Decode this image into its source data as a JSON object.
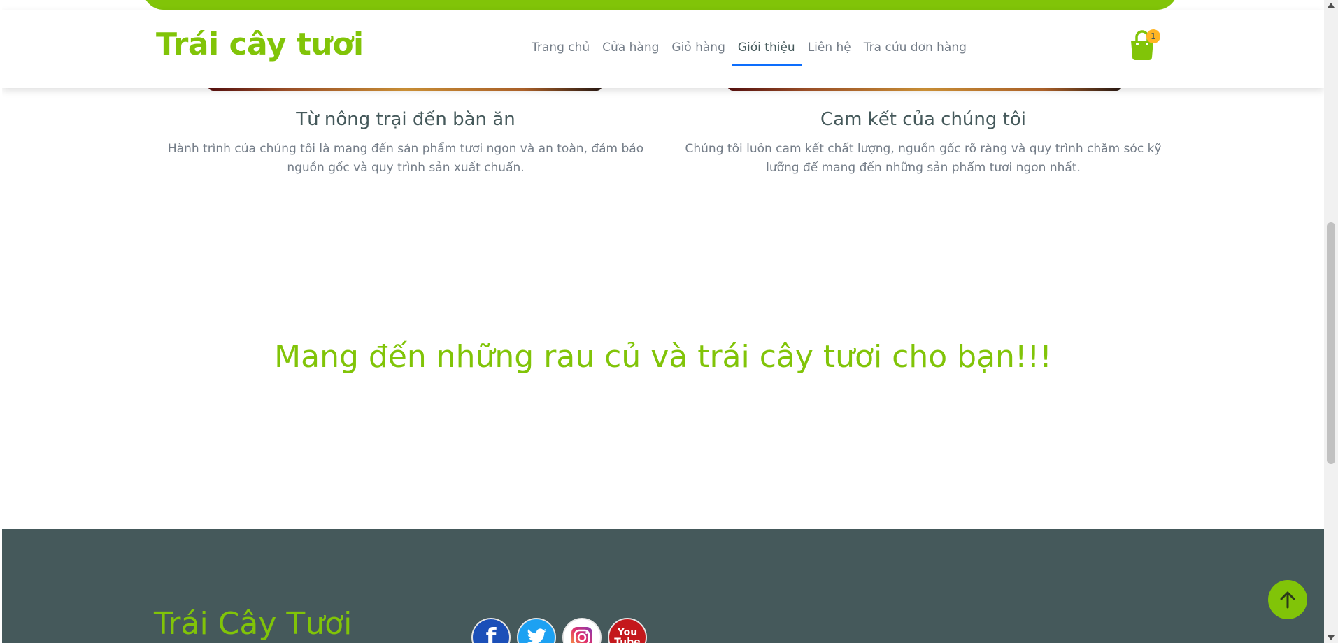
{
  "header": {
    "brand": "Trái cây tươi",
    "nav": [
      {
        "label": "Trang chủ",
        "active": false
      },
      {
        "label": "Cửa hàng",
        "active": false
      },
      {
        "label": "Giỏ hàng",
        "active": false
      },
      {
        "label": "Giới thiệu",
        "active": true
      },
      {
        "label": "Liên hệ",
        "active": false
      },
      {
        "label": "Tra cứu đơn hàng",
        "active": false
      }
    ],
    "cart_icon": "shopping-bag-icon",
    "cart_count": "1"
  },
  "features": [
    {
      "title": "Từ nông trại đến bàn ăn",
      "text": "Hành trình của chúng tôi là mang đến sản phẩm tươi ngon và an toàn, đảm bảo nguồn gốc và quy trình sản xuất chuẩn."
    },
    {
      "title": "Cam kết của chúng tôi",
      "text": "Chúng tôi luôn cam kết chất lượng, nguồn gốc rõ ràng và quy trình chăm sóc kỹ lưỡng để mang đến những sản phẩm tươi ngon nhất."
    }
  ],
  "tagline": "Mang đến những rau củ và trái cây tươi cho bạn!!!",
  "footer": {
    "brand": "Trái Cây Tươi",
    "socials": [
      {
        "name": "facebook-icon",
        "glyph": "f"
      },
      {
        "name": "twitter-icon",
        "glyph": ""
      },
      {
        "name": "instagram-icon",
        "glyph": ""
      },
      {
        "name": "youtube-icon",
        "glyph": "You Tube"
      }
    ]
  },
  "colors": {
    "accent": "#81c408",
    "footer_bg": "#45595b",
    "badge": "#ffb524",
    "nav_active_underline": "#0d6efd"
  }
}
